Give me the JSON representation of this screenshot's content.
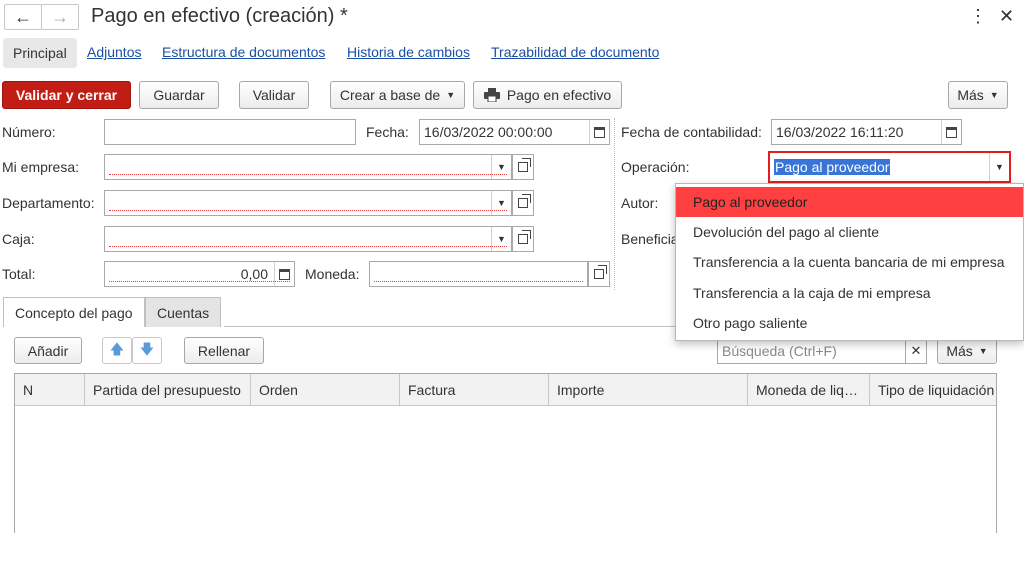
{
  "window": {
    "title": "Pago en efectivo (creación) *",
    "back_icon": "←",
    "forward_icon": "→",
    "more_icon": "⋮",
    "close_icon": "✕"
  },
  "tabs": {
    "active": "Principal",
    "links": [
      "Adjuntos",
      "Estructura de documentos",
      "Historia de cambios",
      "Trazabilidad de documento"
    ]
  },
  "toolbar": {
    "validate_close": "Validar y cerrar",
    "save": "Guardar",
    "validate": "Validar",
    "create_based": "Crear a base de",
    "print_cash": "Pago en efectivo",
    "more": "Más"
  },
  "form": {
    "numero_label": "Número:",
    "numero_value": "",
    "fecha_label": "Fecha:",
    "fecha_value": "16/03/2022 00:00:00",
    "fecha_contab_label": "Fecha de contabilidad:",
    "fecha_contab_value": "16/03/2022 16:11:20",
    "empresa_label": "Mi empresa:",
    "empresa_value": "",
    "operacion_label": "Operación:",
    "operacion_value": "Pago al proveedor",
    "departamento_label": "Departamento:",
    "departamento_value": "",
    "autor_label": "Autor:",
    "caja_label": "Caja:",
    "caja_value": "",
    "beneficiario_label": "Beneficia",
    "total_label": "Total:",
    "total_value": "0,00",
    "moneda_label": "Moneda:",
    "moneda_value": ""
  },
  "operacion_options": [
    "Pago al proveedor",
    "Devolución del pago al cliente",
    "Transferencia a la cuenta bancaria de mi empresa",
    "Transferencia a la caja de mi empresa",
    "Otro pago saliente"
  ],
  "subtabs": [
    "Concepto del pago",
    "Cuentas"
  ],
  "table_toolbar": {
    "add": "Añadir",
    "fill": "Rellenar",
    "search_placeholder": "Búsqueda (Ctrl+F)",
    "more": "Más"
  },
  "table": {
    "columns": [
      "N",
      "Partida del presupuesto",
      "Orden",
      "Factura",
      "Importe",
      "Moneda de liq…",
      "Tipo de liquidación"
    ],
    "rows": []
  },
  "colors": {
    "accent_red": "#c21d14",
    "selection_red": "#ff4040",
    "link_blue": "#1a4fa3",
    "highlight_blue": "#3875d7"
  }
}
